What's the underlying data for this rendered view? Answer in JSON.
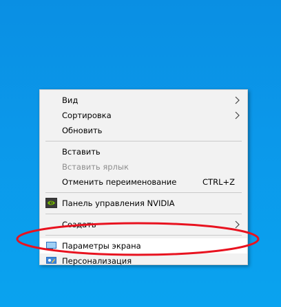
{
  "desktop": {
    "background_color": "#0a98ea"
  },
  "context_menu": {
    "items": [
      {
        "label": "Вид",
        "submenu": true
      },
      {
        "label": "Сортировка",
        "submenu": true
      },
      {
        "label": "Обновить"
      },
      {
        "label": "Вставить"
      },
      {
        "label": "Вставить ярлык",
        "disabled": true
      },
      {
        "label": "Отменить переименование",
        "shortcut": "CTRL+Z"
      },
      {
        "label": "Панель управления NVIDIA",
        "icon": "nvidia-icon"
      },
      {
        "label": "Создать",
        "submenu": true
      },
      {
        "label": "Параметры экрана",
        "icon": "display-settings-icon"
      },
      {
        "label": "Персонализация",
        "icon": "personalization-icon"
      }
    ]
  },
  "annotation": {
    "color": "#e8121f",
    "shape": "ellipse"
  }
}
